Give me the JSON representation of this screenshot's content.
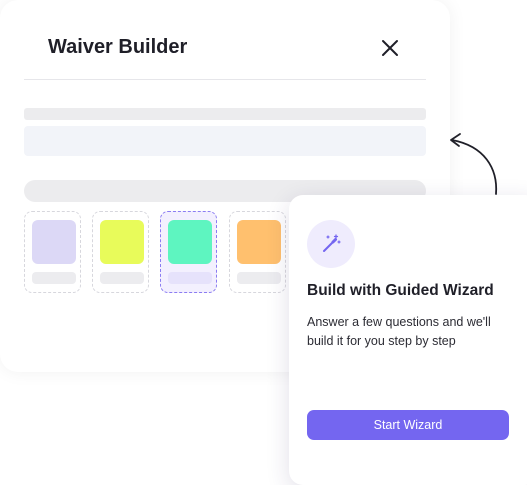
{
  "dialog": {
    "title": "Waiver Builder",
    "close_icon": "close-icon"
  },
  "templates": {
    "swatch_colors": [
      "#dcd8f6",
      "#e8fb5a",
      "#5ef5c0",
      "#ffc06e"
    ],
    "selected_index": 2
  },
  "wizard": {
    "icon": "magic-wand-icon",
    "title": "Build with Guided Wizard",
    "description": "Answer a few questions and we'll build it for you step by step",
    "button_label": "Start Wizard",
    "accent_color": "#7466f0"
  },
  "pointer": {
    "icon": "curved-arrow-icon"
  }
}
